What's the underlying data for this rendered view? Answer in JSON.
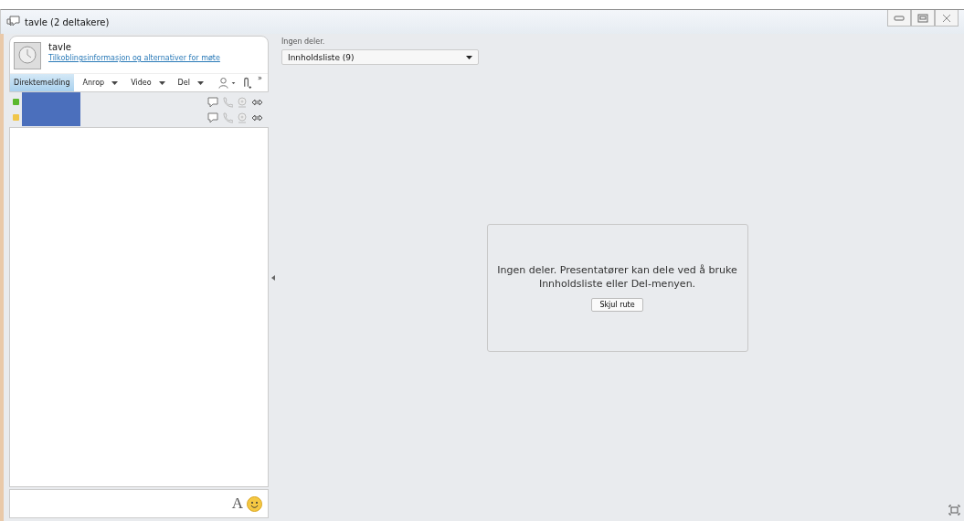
{
  "window": {
    "title": "tavle (2 deltakere)"
  },
  "meeting": {
    "name": "tavle",
    "link": "Tilkoblingsinformasjon og alternativer for møte"
  },
  "tabs": [
    {
      "label": "Direktemelding",
      "selected": true,
      "dropdown": false
    },
    {
      "label": "Anrop",
      "selected": false,
      "dropdown": true
    },
    {
      "label": "Video",
      "selected": false,
      "dropdown": true
    },
    {
      "label": "Del",
      "selected": false,
      "dropdown": true
    }
  ],
  "more": "»",
  "participants": [
    {
      "color": "#5cb82e"
    },
    {
      "color": "#f0c64a"
    }
  ],
  "compose": {
    "font_button": "A"
  },
  "stage": {
    "status": "Ingen deler.",
    "content_list": "Innholdsliste (9)",
    "message": "Ingen deler. Presentatører kan dele ved å bruke Innholdsliste eller Del-menyen.",
    "hide_button": "Skjul rute"
  }
}
